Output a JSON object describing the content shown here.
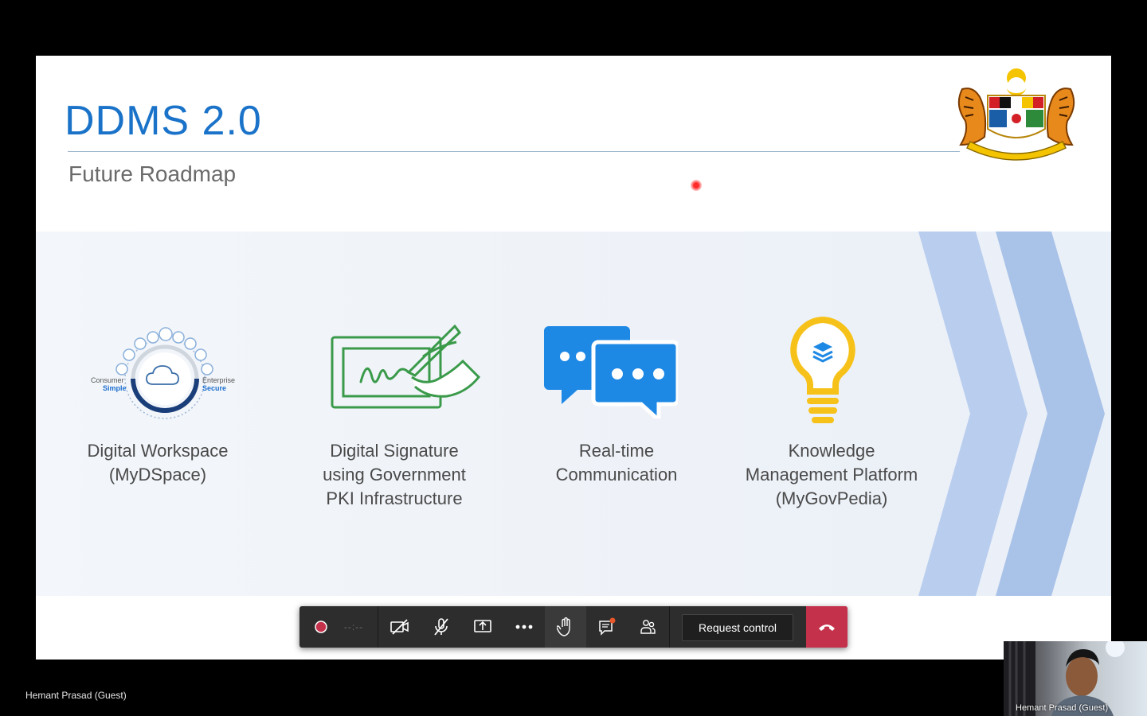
{
  "slide": {
    "title": "DDMS 2.0",
    "subtitle": "Future Roadmap",
    "items": [
      {
        "label": "Digital Workspace\n(MyDSpace)",
        "icon": "workspace-cloud-icon",
        "left_text": "Consumer",
        "left_sub": "Simple",
        "right_text": "Enterprise",
        "right_sub": "Secure"
      },
      {
        "label": "Digital Signature\nusing Government\nPKI Infrastructure",
        "icon": "signature-pen-icon"
      },
      {
        "label": "Real-time\nCommunication",
        "icon": "chat-bubbles-icon"
      },
      {
        "label": "Knowledge\nManagement Platform\n(MyGovPedia)",
        "icon": "lightbulb-icon"
      }
    ],
    "colors": {
      "title": "#1a73c9",
      "chevron": "#a9c2e8",
      "green": "#3a9a4a",
      "blue": "#1e88e5",
      "yellow": "#f6c21a"
    }
  },
  "toolbar": {
    "record_timer": "--:--",
    "request_control_label": "Request control"
  },
  "meeting": {
    "presenter_name": "Hemant Prasad (Guest)",
    "video_name": "Hemant Prasad (Guest)"
  }
}
